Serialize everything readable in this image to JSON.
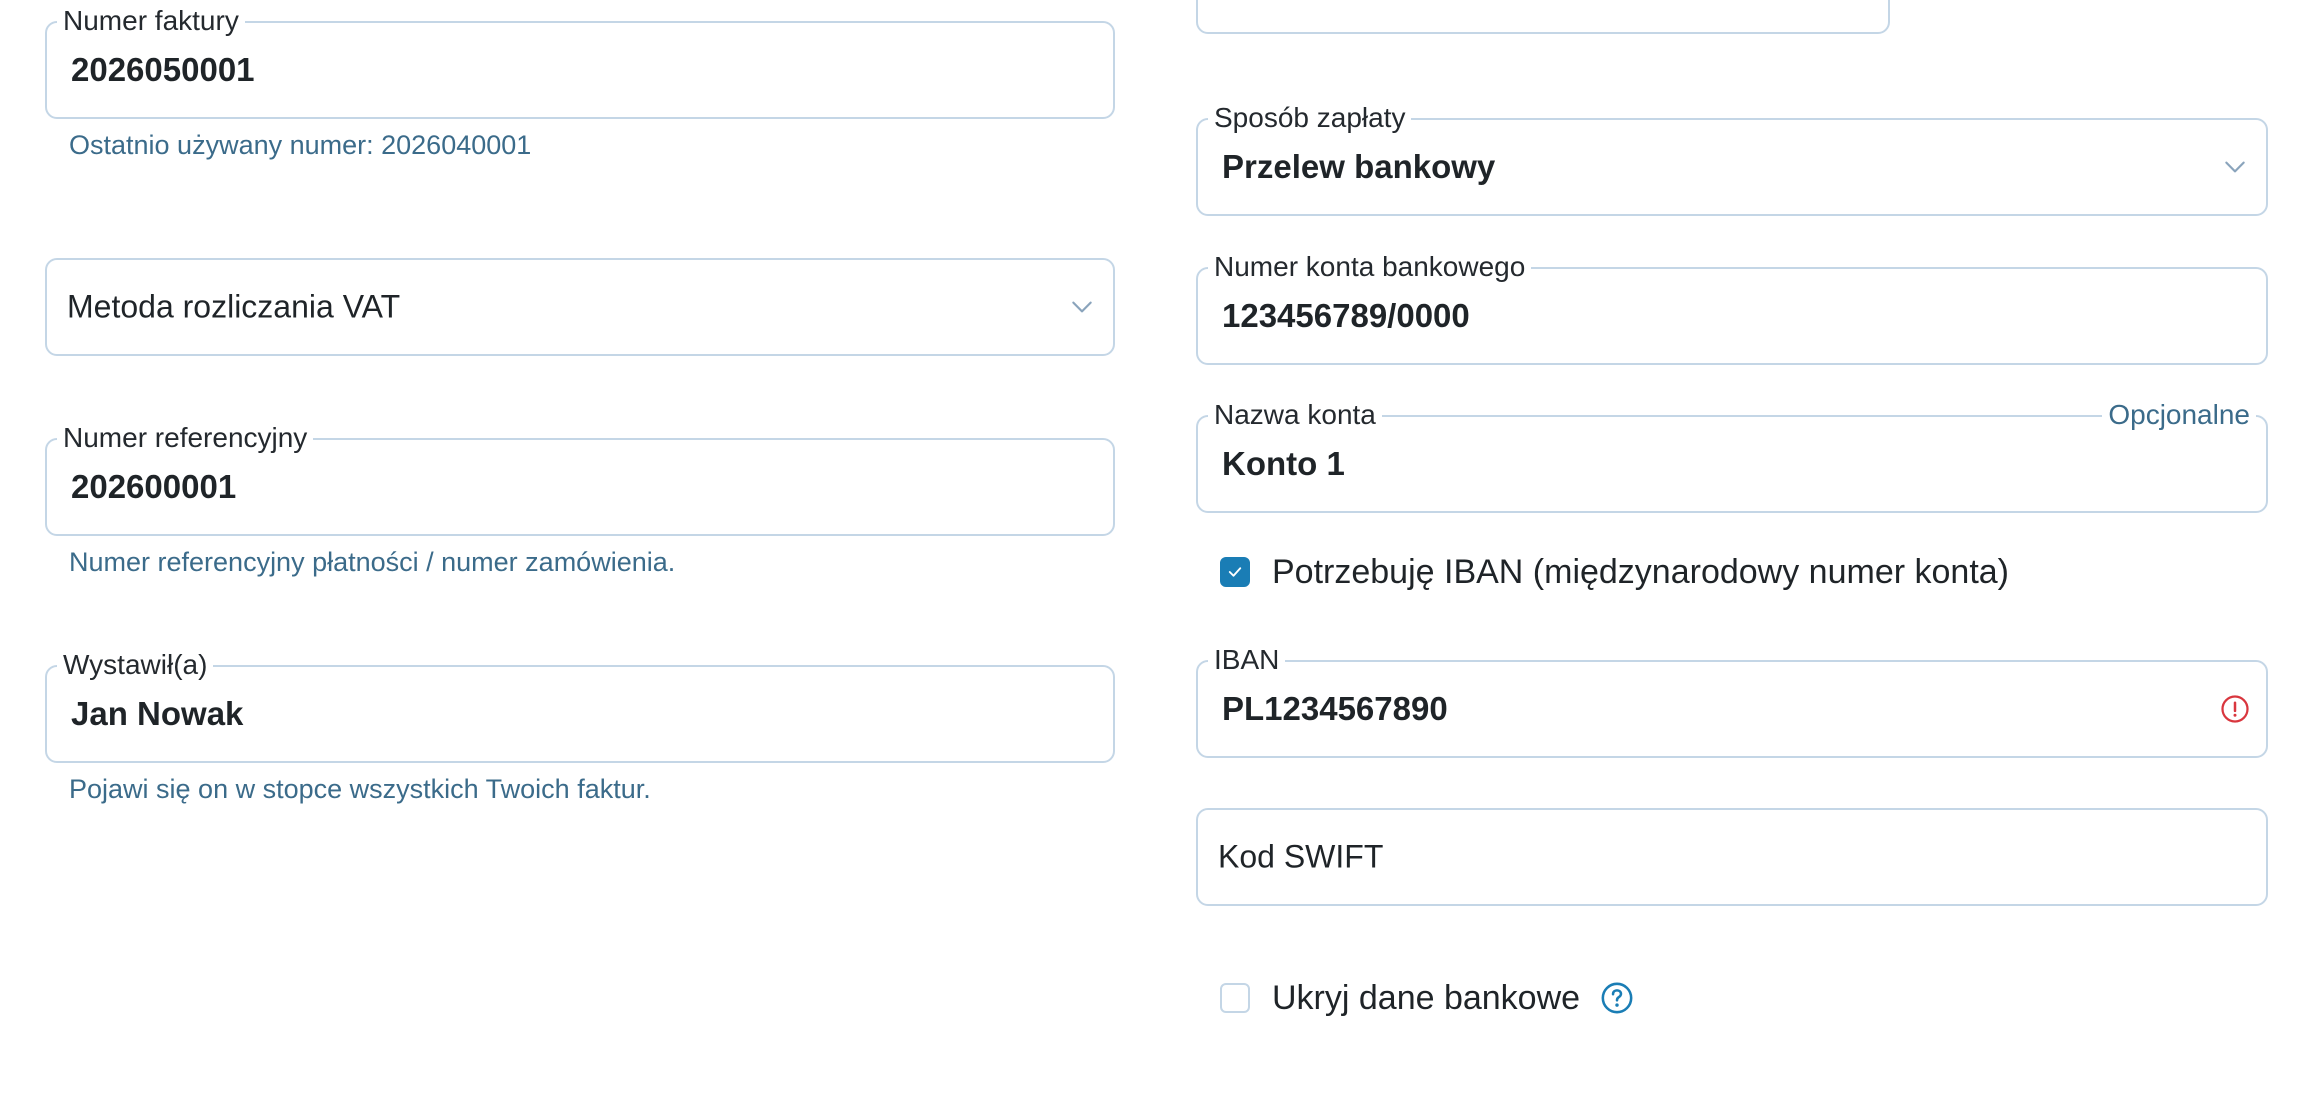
{
  "left": {
    "invoice_number": {
      "label": "Numer faktury",
      "value": "2026050001",
      "helper": "Ostatnio używany numer: 2026040001"
    },
    "vat_method": {
      "placeholder": "Metoda rozliczania VAT"
    },
    "reference_number": {
      "label": "Numer referencyjny",
      "value": "202600001",
      "helper": "Numer referencyjny płatności / numer zamówienia."
    },
    "issued_by": {
      "label": "Wystawił(a)",
      "value": "Jan Nowak",
      "helper": "Pojawi się on w stopce wszystkich Twoich faktur."
    }
  },
  "right": {
    "payment_method": {
      "label": "Sposób zapłaty",
      "value": "Przelew bankowy"
    },
    "bank_account_number": {
      "label": "Numer konta bankowego",
      "value": "123456789/0000"
    },
    "account_name": {
      "label": "Nazwa konta",
      "optional": "Opcjonalne",
      "value": "Konto 1"
    },
    "need_iban": {
      "label": "Potrzebuję IBAN (międzynarodowy numer konta)",
      "checked": true
    },
    "iban": {
      "label": "IBAN",
      "value": "PL1234567890"
    },
    "swift": {
      "placeholder": "Kod SWIFT"
    },
    "hide_bank_details": {
      "label": "Ukryj dane bankowe",
      "checked": false
    }
  },
  "colors": {
    "border": "#c4d6e6",
    "helper_text": "#3b6b8a",
    "accent": "#1a7db5",
    "error": "#d9363e"
  },
  "icons": {
    "dropdown": "chevron-down-icon",
    "error": "alert-circle-icon",
    "help": "question-circle-icon",
    "check": "check-icon"
  }
}
